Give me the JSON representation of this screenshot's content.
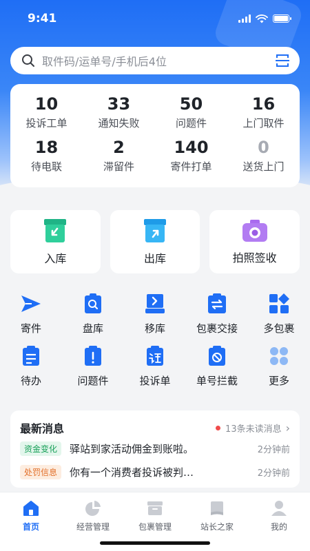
{
  "status": {
    "time": "9:41"
  },
  "search": {
    "placeholder": "取件码/运单号/手机后4位"
  },
  "stats": [
    {
      "num": "10",
      "label": "投诉工单"
    },
    {
      "num": "33",
      "label": "通知失败"
    },
    {
      "num": "50",
      "label": "问题件"
    },
    {
      "num": "16",
      "label": "上门取件"
    },
    {
      "num": "18",
      "label": "待电联"
    },
    {
      "num": "2",
      "label": "滞留件"
    },
    {
      "num": "140",
      "label": "寄件打单"
    },
    {
      "num": "0",
      "label": "送货上门"
    }
  ],
  "cards": [
    {
      "label": "入库"
    },
    {
      "label": "出库"
    },
    {
      "label": "拍照签收"
    }
  ],
  "grid": [
    {
      "label": "寄件",
      "icon": "send-icon"
    },
    {
      "label": "盘库",
      "icon": "inventory-icon"
    },
    {
      "label": "移库",
      "icon": "move-icon"
    },
    {
      "label": "包裹交接",
      "icon": "handover-icon"
    },
    {
      "label": "多包裹",
      "icon": "multi-package-icon"
    },
    {
      "label": "待办",
      "icon": "todo-icon"
    },
    {
      "label": "问题件",
      "icon": "problem-icon"
    },
    {
      "label": "投诉单",
      "icon": "complaint-icon"
    },
    {
      "label": "单号拦截",
      "icon": "intercept-icon"
    },
    {
      "label": "更多",
      "icon": "more-icon"
    }
  ],
  "news": {
    "title": "最新消息",
    "unread": "13条未读消息",
    "items": [
      {
        "tag": "资金变化",
        "text": "驿站到家活动佣金到账啦。",
        "time": "2分钟前"
      },
      {
        "tag": "处罚信息",
        "text": "你有一个消费者投诉被判…",
        "time": "2分钟前"
      }
    ]
  },
  "tabs": [
    {
      "label": "首页"
    },
    {
      "label": "经营管理"
    },
    {
      "label": "包裹管理"
    },
    {
      "label": "站长之家"
    },
    {
      "label": "我的"
    }
  ],
  "colors": {
    "primary": "#1f6ef5",
    "green": "#22b07d",
    "purple": "#9b5de5",
    "red": "#f04b4b"
  }
}
